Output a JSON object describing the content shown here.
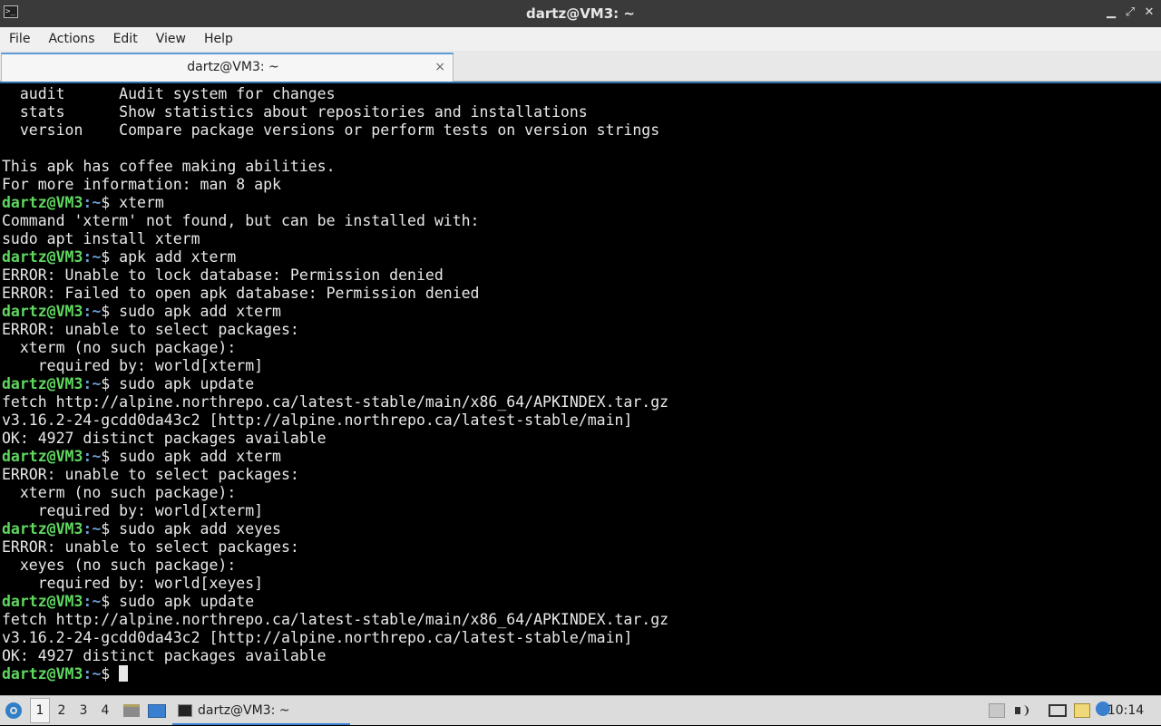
{
  "window": {
    "title": "dartz@VM3: ~",
    "minimize_glyph": "▁",
    "maximize_glyph": "⤢",
    "close_glyph": "✕"
  },
  "menu": [
    "File",
    "Actions",
    "Edit",
    "View",
    "Help"
  ],
  "tab": {
    "label": "dartz@VM3: ~",
    "close_glyph": "×"
  },
  "prompt": {
    "user_host": "dartz@VM3",
    "sep": ":",
    "path": "~",
    "symbol": "$ "
  },
  "terminal": {
    "lines": [
      {
        "t": "text",
        "v": "  audit      Audit system for changes"
      },
      {
        "t": "text",
        "v": "  stats      Show statistics about repositories and installations"
      },
      {
        "t": "text",
        "v": "  version    Compare package versions or perform tests on version strings"
      },
      {
        "t": "text",
        "v": ""
      },
      {
        "t": "text",
        "v": "This apk has coffee making abilities."
      },
      {
        "t": "text",
        "v": "For more information: man 8 apk"
      },
      {
        "t": "prompt",
        "v": "xterm"
      },
      {
        "t": "text",
        "v": "Command 'xterm' not found, but can be installed with:"
      },
      {
        "t": "text",
        "v": "sudo apt install xterm"
      },
      {
        "t": "prompt",
        "v": "apk add xterm"
      },
      {
        "t": "text",
        "v": "ERROR: Unable to lock database: Permission denied"
      },
      {
        "t": "text",
        "v": "ERROR: Failed to open apk database: Permission denied"
      },
      {
        "t": "prompt",
        "v": "sudo apk add xterm"
      },
      {
        "t": "text",
        "v": "ERROR: unable to select packages:"
      },
      {
        "t": "text",
        "v": "  xterm (no such package):"
      },
      {
        "t": "text",
        "v": "    required by: world[xterm]"
      },
      {
        "t": "prompt",
        "v": "sudo apk update"
      },
      {
        "t": "text",
        "v": "fetch http://alpine.northrepo.ca/latest-stable/main/x86_64/APKINDEX.tar.gz"
      },
      {
        "t": "text",
        "v": "v3.16.2-24-gcdd0da43c2 [http://alpine.northrepo.ca/latest-stable/main]"
      },
      {
        "t": "text",
        "v": "OK: 4927 distinct packages available"
      },
      {
        "t": "prompt",
        "v": "sudo apk add xterm"
      },
      {
        "t": "text",
        "v": "ERROR: unable to select packages:"
      },
      {
        "t": "text",
        "v": "  xterm (no such package):"
      },
      {
        "t": "text",
        "v": "    required by: world[xterm]"
      },
      {
        "t": "prompt",
        "v": "sudo apk add xeyes"
      },
      {
        "t": "text",
        "v": "ERROR: unable to select packages:"
      },
      {
        "t": "text",
        "v": "  xeyes (no such package):"
      },
      {
        "t": "text",
        "v": "    required by: world[xeyes]"
      },
      {
        "t": "prompt",
        "v": "sudo apk update"
      },
      {
        "t": "text",
        "v": "fetch http://alpine.northrepo.ca/latest-stable/main/x86_64/APKINDEX.tar.gz"
      },
      {
        "t": "text",
        "v": "v3.16.2-24-gcdd0da43c2 [http://alpine.northrepo.ca/latest-stable/main]"
      },
      {
        "t": "text",
        "v": "OK: 4927 distinct packages available"
      },
      {
        "t": "cursor",
        "v": ""
      }
    ]
  },
  "taskbar": {
    "workspaces": [
      "1",
      "2",
      "3",
      "4"
    ],
    "active_workspace": "1",
    "task_label": "dartz@VM3: ~",
    "clock": "10:14"
  }
}
